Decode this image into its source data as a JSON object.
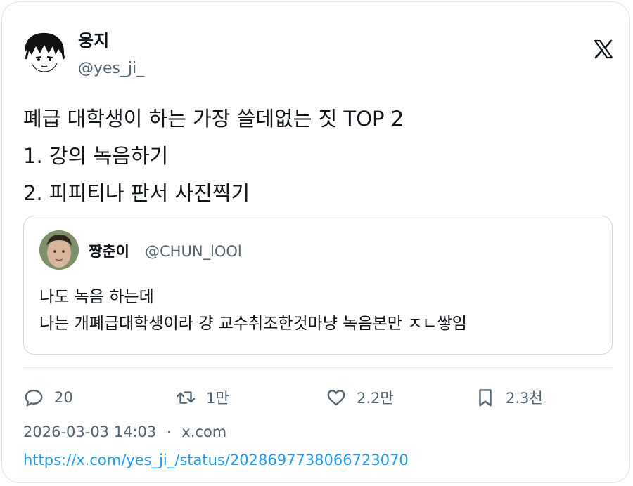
{
  "tweet": {
    "author": {
      "name": "웅지",
      "handle": "@yes_ji_"
    },
    "brand_icon": "x-logo-icon",
    "text_lines": [
      "폐급 대학생이 하는 가장 쓸데없는 짓 TOP 2",
      "1. 강의 녹음하기",
      "2. 피피티나 판서 사진찍기"
    ],
    "quote": {
      "author_name": "짱춘이",
      "author_handle": "@CHUN_lOOl",
      "text_lines": [
        "나도 녹음 하는데",
        "나는 개폐급대학생이라 걍 교수취조한것마냥 녹음본만 ㅈㄴ쌓임"
      ]
    },
    "actions": {
      "replies": {
        "icon": "reply-icon",
        "count": "20"
      },
      "retweets": {
        "icon": "retweet-icon",
        "count": "1만"
      },
      "likes": {
        "icon": "heart-icon",
        "count": "2.2만"
      },
      "bookmarks": {
        "icon": "bookmark-icon",
        "count": "2.3천"
      }
    },
    "timestamp": "2026-03-03 14:03",
    "separator": "·",
    "source": "x.com",
    "url": "https://x.com/yes_ji_/status/2028697738066723070"
  },
  "colors": {
    "text": "#0f1419",
    "secondary": "#536471",
    "link": "#1d9bf0",
    "border": "#cfd9de"
  }
}
